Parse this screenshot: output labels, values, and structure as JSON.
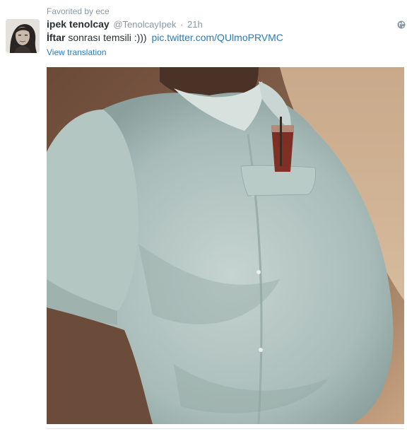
{
  "context": {
    "favorited_by": "Favorited by ece"
  },
  "tweet": {
    "fullname": "ipek tenolcay",
    "username": "@TenolcayIpek",
    "separator": "·",
    "time": "21h",
    "text_bold": "İftar",
    "text_rest": "sonrası temsili :)))",
    "link": "pic.twitter.com/QUlmoPRVMC",
    "translate_label": "View translation"
  },
  "icons": {
    "avatar": "avatar",
    "globe": "globe-icon",
    "media": "tweet-photo"
  },
  "colors": {
    "name": "#292f33",
    "muted": "#8899a6",
    "link": "#2b7bb9"
  }
}
